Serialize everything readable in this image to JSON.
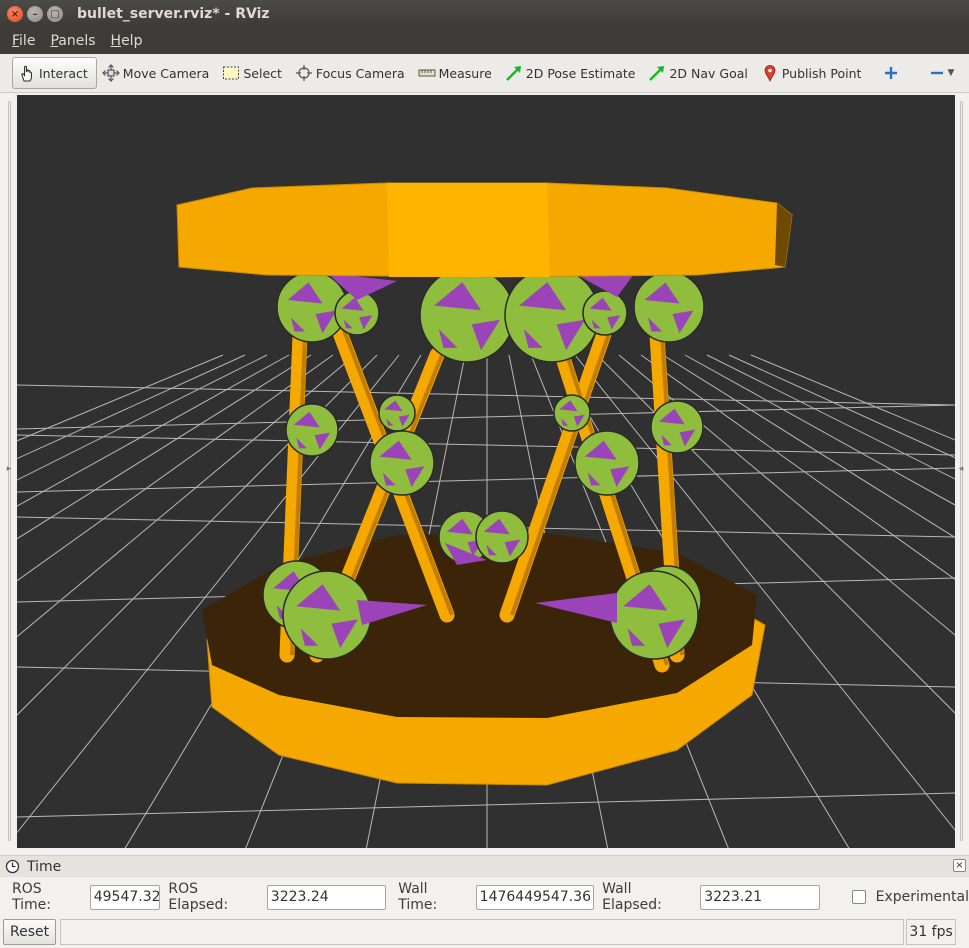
{
  "window": {
    "title": "bullet_server.rviz* - RViz",
    "close_glyph": "×",
    "min_glyph": "–",
    "max_glyph": "□"
  },
  "menu": [
    {
      "label": "File",
      "underline": "F",
      "rest": "ile"
    },
    {
      "label": "Panels",
      "underline": "P",
      "rest": "anels"
    },
    {
      "label": "Help",
      "underline": "H",
      "rest": "elp"
    }
  ],
  "toolbar": {
    "tools": [
      {
        "label": "Interact",
        "icon": "hand-icon",
        "active": true
      },
      {
        "label": "Move Camera",
        "icon": "move-camera-icon",
        "active": false
      },
      {
        "label": "Select",
        "icon": "select-icon",
        "active": false
      },
      {
        "label": "Focus Camera",
        "icon": "focus-camera-icon",
        "active": false
      },
      {
        "label": "Measure",
        "icon": "measure-icon",
        "active": false
      },
      {
        "label": "2D Pose Estimate",
        "icon": "green-arrow-icon",
        "active": false
      },
      {
        "label": "2D Nav Goal",
        "icon": "green-arrow-icon",
        "active": false
      },
      {
        "label": "Publish Point",
        "icon": "map-pin-icon",
        "active": false
      }
    ],
    "add_tool_icon": "plus-icon",
    "remove_tool_icon": "minus-icon",
    "dropdown_icon": "chevron-down-icon"
  },
  "scene": {
    "background_color": "#303030",
    "grid_color": "#b8b8b8",
    "platform_color": "#f5a800",
    "base_top_color": "#3b2408",
    "link_color": "#f5a800",
    "joint_colors": [
      "#8fbd3e",
      "#9b43b8"
    ]
  },
  "time_panel": {
    "title": "Time",
    "close_glyph": "×",
    "ros_time_label": "ROS Time:",
    "ros_time_value": "49547.32",
    "ros_elapsed_label": "ROS Elapsed:",
    "ros_elapsed_value": "3223.24",
    "wall_time_label": "Wall Time:",
    "wall_time_value": "1476449547.36",
    "wall_elapsed_label": "Wall Elapsed:",
    "wall_elapsed_value": "3223.21",
    "experimental_label": "Experimental",
    "experimental_checked": false
  },
  "status": {
    "reset_label": "Reset",
    "fps": "31 fps"
  }
}
